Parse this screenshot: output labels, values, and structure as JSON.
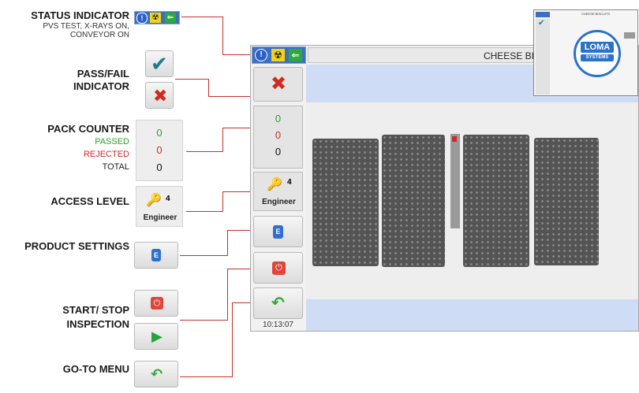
{
  "labels": {
    "status_indicator": "STATUS INDICATOR",
    "status_sub1": "PVS TEST, X-RAYS ON,",
    "status_sub2": "CONVEYOR ON",
    "pass_fail_1": "PASS/FAIL",
    "pass_fail_2": "INDICATOR",
    "pack_counter": "PACK COUNTER",
    "passed": "PASSED",
    "rejected": "REJECTED",
    "total": "TOTAL",
    "access_level": "ACCESS LEVEL",
    "product_settings": "PRODUCT SETTINGS",
    "start_stop_1": "START/ STOP",
    "start_stop_2": "INSPECTION",
    "goto_menu": "GO-TO MENU"
  },
  "counter": {
    "passed": "0",
    "rejected": "0",
    "total": "0"
  },
  "access": {
    "level": "4",
    "role": "Engineer"
  },
  "main": {
    "product_title": "CHEESE BISCUITS",
    "counter_passed": "0",
    "counter_rejected": "0",
    "counter_total": "0",
    "access_level": "4",
    "access_role": "Engineer",
    "time": "10:13:07"
  },
  "thumbnail": {
    "title": "CHEESE BISCUITS",
    "logo_line1": "LOMA",
    "logo_line2": "SYSTEMS"
  },
  "colors": {
    "connector": "#c5312c",
    "passed": "#2ca02c",
    "rejected": "#d62728",
    "panel": "#e6e6e6",
    "image_bg": "#cfdcf5"
  }
}
